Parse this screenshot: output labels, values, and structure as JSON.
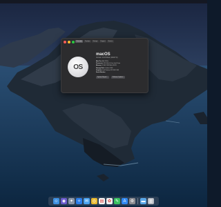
{
  "about_window": {
    "tabs": [
      "Overview",
      "Displays",
      "Storage",
      "Support",
      "Service"
    ],
    "active_tab": "Overview",
    "logo_text": "OS",
    "os_name": "macOS",
    "os_version": "Version 10.15 Beta (19A471t)",
    "specs": [
      {
        "label": "Mac Pro",
        "value": "(Mid 2010)"
      },
      {
        "label": "Processor",
        "value": "3.33 GHz 6-Core Intel Xeon"
      },
      {
        "label": "Memory",
        "value": "24 GB 1333 MHz DDR3"
      },
      {
        "label": "Startup Disk",
        "value": "Catalina SSD"
      },
      {
        "label": "Graphics",
        "value": "Intel Radeon RX 580 8 GB"
      },
      {
        "label": "Serial Number",
        "value": ""
      }
    ],
    "buttons": [
      "System Report...",
      "Software Update..."
    ]
  },
  "dock": {
    "items": [
      {
        "name": "finder-icon",
        "glyph": "☺",
        "bg": "#3d8fe0"
      },
      {
        "name": "siri-icon",
        "glyph": "◉",
        "bg": "#6a5acd"
      },
      {
        "name": "launchpad-icon",
        "glyph": "✦",
        "bg": "#8a96a8"
      },
      {
        "name": "safari-icon",
        "glyph": "✧",
        "bg": "#2b7de9"
      },
      {
        "name": "mail-icon",
        "glyph": "✉",
        "bg": "#4aa3f0"
      },
      {
        "name": "chrome-icon",
        "glyph": "◎",
        "bg": "#e8b92e"
      },
      {
        "name": "calendar-icon",
        "glyph": "▤",
        "bg": "#f2f2f2"
      },
      {
        "name": "photos-icon",
        "glyph": "✿",
        "bg": "#f0f0f0"
      },
      {
        "name": "messages-icon",
        "glyph": "✎",
        "bg": "#3ac260"
      },
      {
        "name": "app-store-icon",
        "glyph": "A",
        "bg": "#2f88f2"
      },
      {
        "name": "system-preferences-icon",
        "glyph": "⚙",
        "bg": "#8e8e93"
      },
      {
        "name": "folder-icon",
        "glyph": "▬",
        "bg": "#5aa7e8"
      },
      {
        "name": "trash-icon",
        "glyph": "▥",
        "bg": "#b8bcc4"
      }
    ]
  }
}
